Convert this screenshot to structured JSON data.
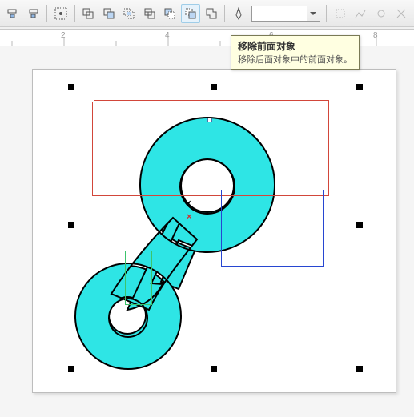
{
  "toolbar": {
    "icons": {
      "align_left": "align-distribute-icon-1",
      "align_right": "align-distribute-icon-2",
      "pick_object": "eyedropper-icon",
      "shaping_union": "union-icon",
      "shaping_trim": "trim-icon",
      "shaping_intersect": "intersect-icon",
      "shaping_simplify": "simplify-icon",
      "shaping_front_minus_back": "front-minus-back-icon",
      "shaping_back_minus_front": "back-minus-front-icon",
      "shaping_boundary": "boundary-icon",
      "pen": "pen-icon",
      "color_well": "fill-color-well",
      "dropdown": "fill-dropdown",
      "tool_a": "extra-icon-1",
      "tool_b": "extra-icon-2",
      "tool_c": "extra-icon-3",
      "tool_d": "extra-icon-4"
    },
    "fill_color": "#ffffff"
  },
  "tooltip": {
    "title": "移除前面对象",
    "description": "移除后面对象中的前面对象。"
  },
  "ruler": {
    "labels": [
      "2",
      "4",
      "6",
      "8"
    ],
    "positions": [
      80,
      210,
      340,
      470
    ]
  },
  "canvas": {
    "center_marker": "×"
  }
}
